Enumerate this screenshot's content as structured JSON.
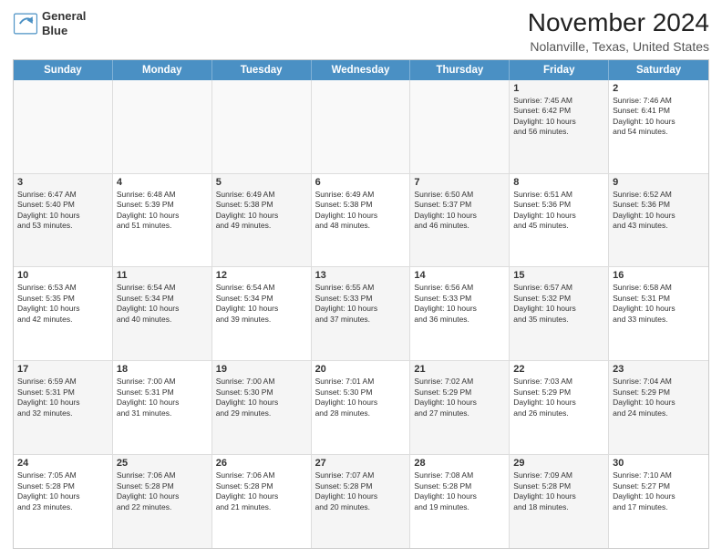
{
  "logo": {
    "line1": "General",
    "line2": "Blue"
  },
  "title": "November 2024",
  "subtitle": "Nolanville, Texas, United States",
  "weekdays": [
    "Sunday",
    "Monday",
    "Tuesday",
    "Wednesday",
    "Thursday",
    "Friday",
    "Saturday"
  ],
  "weeks": [
    [
      {
        "day": "",
        "info": ""
      },
      {
        "day": "",
        "info": ""
      },
      {
        "day": "",
        "info": ""
      },
      {
        "day": "",
        "info": ""
      },
      {
        "day": "",
        "info": ""
      },
      {
        "day": "1",
        "info": "Sunrise: 7:45 AM\nSunset: 6:42 PM\nDaylight: 10 hours\nand 56 minutes."
      },
      {
        "day": "2",
        "info": "Sunrise: 7:46 AM\nSunset: 6:41 PM\nDaylight: 10 hours\nand 54 minutes."
      }
    ],
    [
      {
        "day": "3",
        "info": "Sunrise: 6:47 AM\nSunset: 5:40 PM\nDaylight: 10 hours\nand 53 minutes."
      },
      {
        "day": "4",
        "info": "Sunrise: 6:48 AM\nSunset: 5:39 PM\nDaylight: 10 hours\nand 51 minutes."
      },
      {
        "day": "5",
        "info": "Sunrise: 6:49 AM\nSunset: 5:38 PM\nDaylight: 10 hours\nand 49 minutes."
      },
      {
        "day": "6",
        "info": "Sunrise: 6:49 AM\nSunset: 5:38 PM\nDaylight: 10 hours\nand 48 minutes."
      },
      {
        "day": "7",
        "info": "Sunrise: 6:50 AM\nSunset: 5:37 PM\nDaylight: 10 hours\nand 46 minutes."
      },
      {
        "day": "8",
        "info": "Sunrise: 6:51 AM\nSunset: 5:36 PM\nDaylight: 10 hours\nand 45 minutes."
      },
      {
        "day": "9",
        "info": "Sunrise: 6:52 AM\nSunset: 5:36 PM\nDaylight: 10 hours\nand 43 minutes."
      }
    ],
    [
      {
        "day": "10",
        "info": "Sunrise: 6:53 AM\nSunset: 5:35 PM\nDaylight: 10 hours\nand 42 minutes."
      },
      {
        "day": "11",
        "info": "Sunrise: 6:54 AM\nSunset: 5:34 PM\nDaylight: 10 hours\nand 40 minutes."
      },
      {
        "day": "12",
        "info": "Sunrise: 6:54 AM\nSunset: 5:34 PM\nDaylight: 10 hours\nand 39 minutes."
      },
      {
        "day": "13",
        "info": "Sunrise: 6:55 AM\nSunset: 5:33 PM\nDaylight: 10 hours\nand 37 minutes."
      },
      {
        "day": "14",
        "info": "Sunrise: 6:56 AM\nSunset: 5:33 PM\nDaylight: 10 hours\nand 36 minutes."
      },
      {
        "day": "15",
        "info": "Sunrise: 6:57 AM\nSunset: 5:32 PM\nDaylight: 10 hours\nand 35 minutes."
      },
      {
        "day": "16",
        "info": "Sunrise: 6:58 AM\nSunset: 5:31 PM\nDaylight: 10 hours\nand 33 minutes."
      }
    ],
    [
      {
        "day": "17",
        "info": "Sunrise: 6:59 AM\nSunset: 5:31 PM\nDaylight: 10 hours\nand 32 minutes."
      },
      {
        "day": "18",
        "info": "Sunrise: 7:00 AM\nSunset: 5:31 PM\nDaylight: 10 hours\nand 31 minutes."
      },
      {
        "day": "19",
        "info": "Sunrise: 7:00 AM\nSunset: 5:30 PM\nDaylight: 10 hours\nand 29 minutes."
      },
      {
        "day": "20",
        "info": "Sunrise: 7:01 AM\nSunset: 5:30 PM\nDaylight: 10 hours\nand 28 minutes."
      },
      {
        "day": "21",
        "info": "Sunrise: 7:02 AM\nSunset: 5:29 PM\nDaylight: 10 hours\nand 27 minutes."
      },
      {
        "day": "22",
        "info": "Sunrise: 7:03 AM\nSunset: 5:29 PM\nDaylight: 10 hours\nand 26 minutes."
      },
      {
        "day": "23",
        "info": "Sunrise: 7:04 AM\nSunset: 5:29 PM\nDaylight: 10 hours\nand 24 minutes."
      }
    ],
    [
      {
        "day": "24",
        "info": "Sunrise: 7:05 AM\nSunset: 5:28 PM\nDaylight: 10 hours\nand 23 minutes."
      },
      {
        "day": "25",
        "info": "Sunrise: 7:06 AM\nSunset: 5:28 PM\nDaylight: 10 hours\nand 22 minutes."
      },
      {
        "day": "26",
        "info": "Sunrise: 7:06 AM\nSunset: 5:28 PM\nDaylight: 10 hours\nand 21 minutes."
      },
      {
        "day": "27",
        "info": "Sunrise: 7:07 AM\nSunset: 5:28 PM\nDaylight: 10 hours\nand 20 minutes."
      },
      {
        "day": "28",
        "info": "Sunrise: 7:08 AM\nSunset: 5:28 PM\nDaylight: 10 hours\nand 19 minutes."
      },
      {
        "day": "29",
        "info": "Sunrise: 7:09 AM\nSunset: 5:28 PM\nDaylight: 10 hours\nand 18 minutes."
      },
      {
        "day": "30",
        "info": "Sunrise: 7:10 AM\nSunset: 5:27 PM\nDaylight: 10 hours\nand 17 minutes."
      }
    ]
  ]
}
